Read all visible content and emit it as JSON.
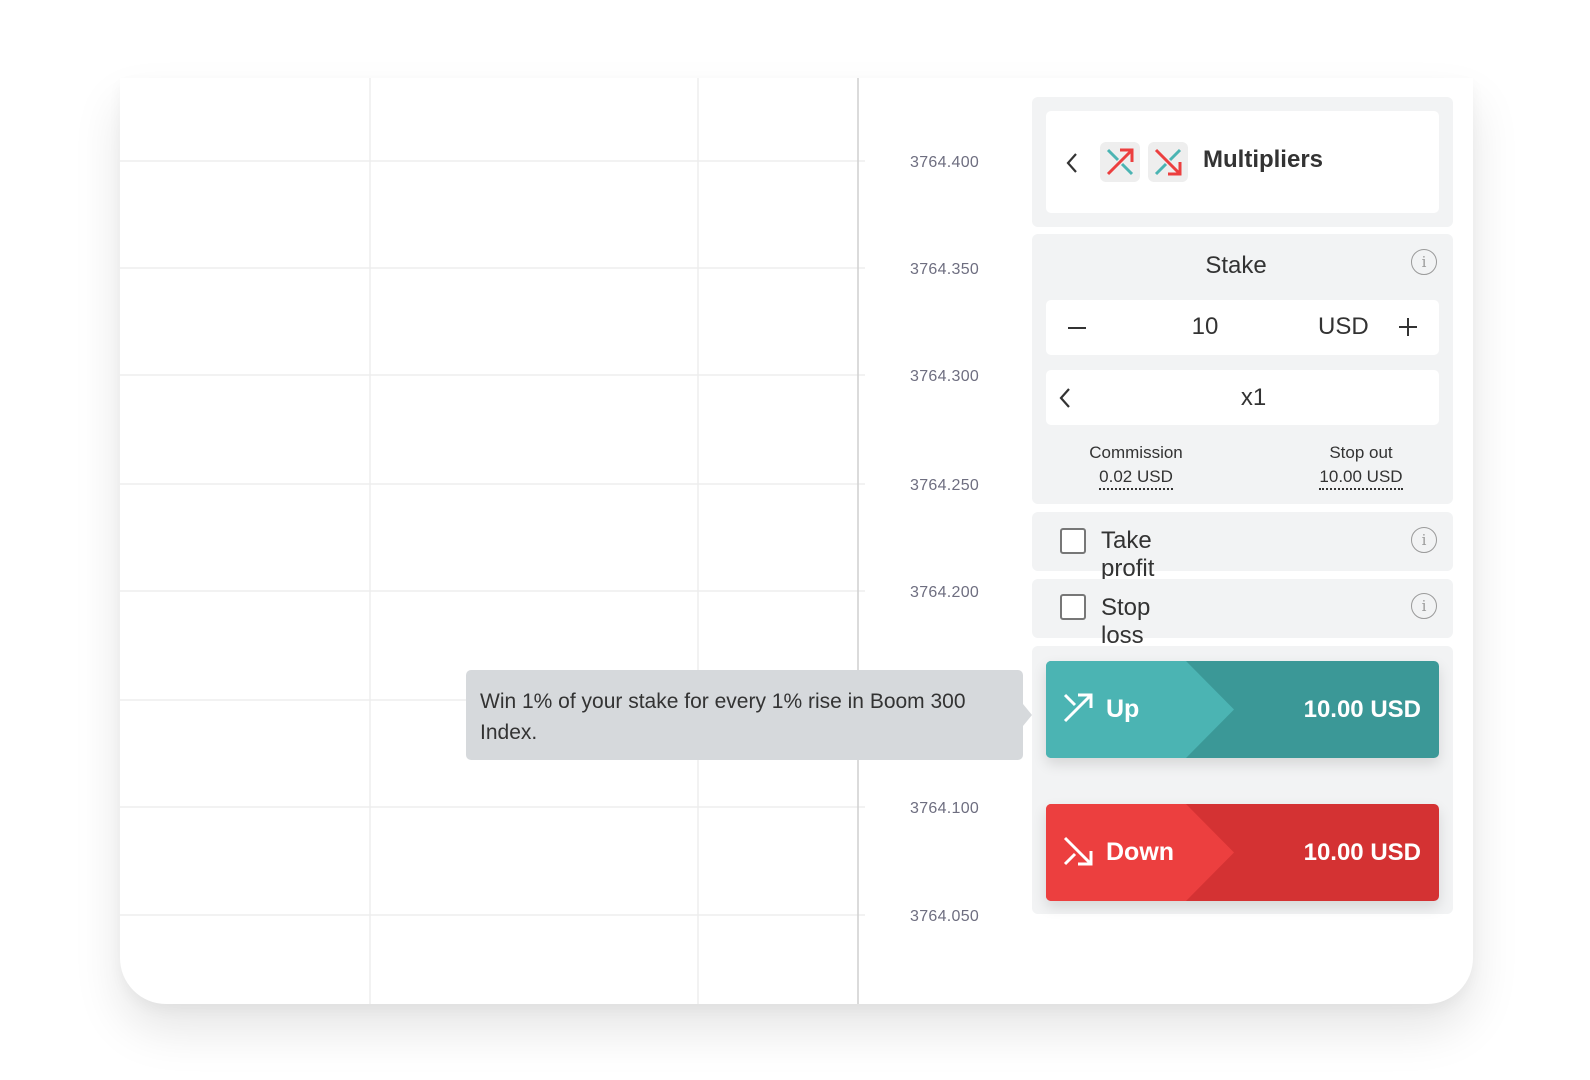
{
  "chart": {
    "price_ticks": [
      "3764.400",
      "3764.350",
      "3764.300",
      "3764.250",
      "3764.200",
      "3764.100",
      "3764.050"
    ]
  },
  "trade_panel": {
    "header": {
      "title": "Multipliers",
      "icons": [
        "back-chevron",
        "multiplier-up-icon",
        "multiplier-down-icon"
      ]
    },
    "stake": {
      "label": "Stake",
      "value": "10",
      "currency": "USD",
      "minus": "−",
      "plus": "+"
    },
    "multiplier": {
      "value": "x1"
    },
    "commission": {
      "label": "Commission",
      "value": "0.02 USD"
    },
    "stop_out": {
      "label": "Stop out",
      "value": "10.00 USD"
    },
    "take_profit": {
      "label": "Take profit",
      "checked": false
    },
    "stop_loss": {
      "label": "Stop loss",
      "checked": false
    },
    "up_button": {
      "label": "Up",
      "amount": "10.00 USD",
      "color": "#4bb4b3",
      "color_dark": "#3b9897"
    },
    "down_button": {
      "label": "Down",
      "amount": "10.00 USD",
      "color": "#ec3f3f",
      "color_dark": "#d43233"
    }
  },
  "tooltip": {
    "text": "Win 1% of your stake for every 1% rise in Boom 300 Index."
  }
}
